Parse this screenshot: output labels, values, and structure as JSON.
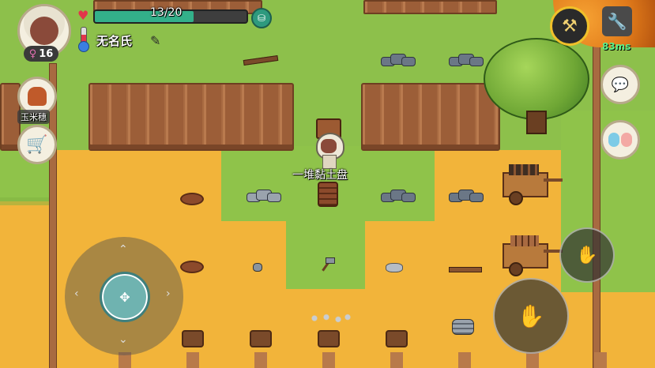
{
  "hud": {
    "hp_text": "13/20",
    "hp_fraction": 0.65,
    "gender_level": "16",
    "player_name": "无名氏",
    "ping": "83ms",
    "npc_label": "玉米穗",
    "item_hover_label": "一堆黏土盘"
  },
  "colors": {
    "hp_fill": "#33b08a",
    "sand": "#f2b43a",
    "grass": "#8fc34a",
    "fence": "#9c5e38"
  },
  "icons": {
    "heart": "heart-icon",
    "thermometer": "thermometer-icon",
    "edit": "pencil-icon",
    "bag": "bag-icon",
    "settings": "wrench-icon",
    "chat": "chat-bubble-icon",
    "social": "friends-icon",
    "shop": "cart-icon",
    "action": "hammer-icon",
    "grab": "hand-icon"
  }
}
